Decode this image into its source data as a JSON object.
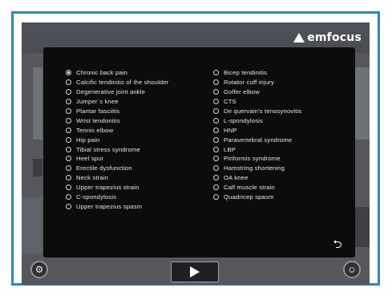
{
  "brand": {
    "logo_text": "emfocus"
  },
  "condition_list": {
    "left_column": [
      {
        "label": "Chronic back pain",
        "selected": true
      },
      {
        "label": "Calcific tendinitis of the shoulder",
        "selected": false
      },
      {
        "label": "Degenerative joint ankle",
        "selected": false
      },
      {
        "label": "Jumper`s knee",
        "selected": false
      },
      {
        "label": "Plantar fasciitis",
        "selected": false
      },
      {
        "label": "Wrist tendonitis",
        "selected": false
      },
      {
        "label": "Tennis elbow",
        "selected": false
      },
      {
        "label": "Hip pain",
        "selected": false
      },
      {
        "label": "Tibial stress syndrome",
        "selected": false
      },
      {
        "label": "Heel spur",
        "selected": false
      },
      {
        "label": "Erectile dysfunction",
        "selected": false
      },
      {
        "label": "Neck strain",
        "selected": false
      },
      {
        "label": "Upper trapezius strain",
        "selected": false
      },
      {
        "label": "C-spondylosis",
        "selected": false
      },
      {
        "label": "Upper trapezius spasm",
        "selected": false
      }
    ],
    "right_column": [
      {
        "label": "Bicep tendinitis",
        "selected": false
      },
      {
        "label": "Rotator cuff injury",
        "selected": false
      },
      {
        "label": "Golfer elbow",
        "selected": false
      },
      {
        "label": "CTS",
        "selected": false
      },
      {
        "label": "De quervain's tenosynovitis",
        "selected": false
      },
      {
        "label": "L-spondylosis",
        "selected": false
      },
      {
        "label": "HNP",
        "selected": false
      },
      {
        "label": "Paravertebral syndrome",
        "selected": false
      },
      {
        "label": "LBP",
        "selected": false
      },
      {
        "label": "Piriformis syndrome",
        "selected": false
      },
      {
        "label": "Hamstring shortening",
        "selected": false
      },
      {
        "label": "OA knee",
        "selected": false
      },
      {
        "label": "Calf muscle strain",
        "selected": false
      },
      {
        "label": "Quadricep spasm",
        "selected": false
      }
    ]
  },
  "icons": {
    "back": "return-arrow-icon",
    "settings": "gear-icon",
    "profile": "user-icon",
    "play": "play-icon"
  },
  "colors": {
    "frame_border": "#2a8ac4",
    "modal_bg": "#0c0c0d",
    "screen_bg": "#55575c",
    "text": "#e6e6e6"
  }
}
